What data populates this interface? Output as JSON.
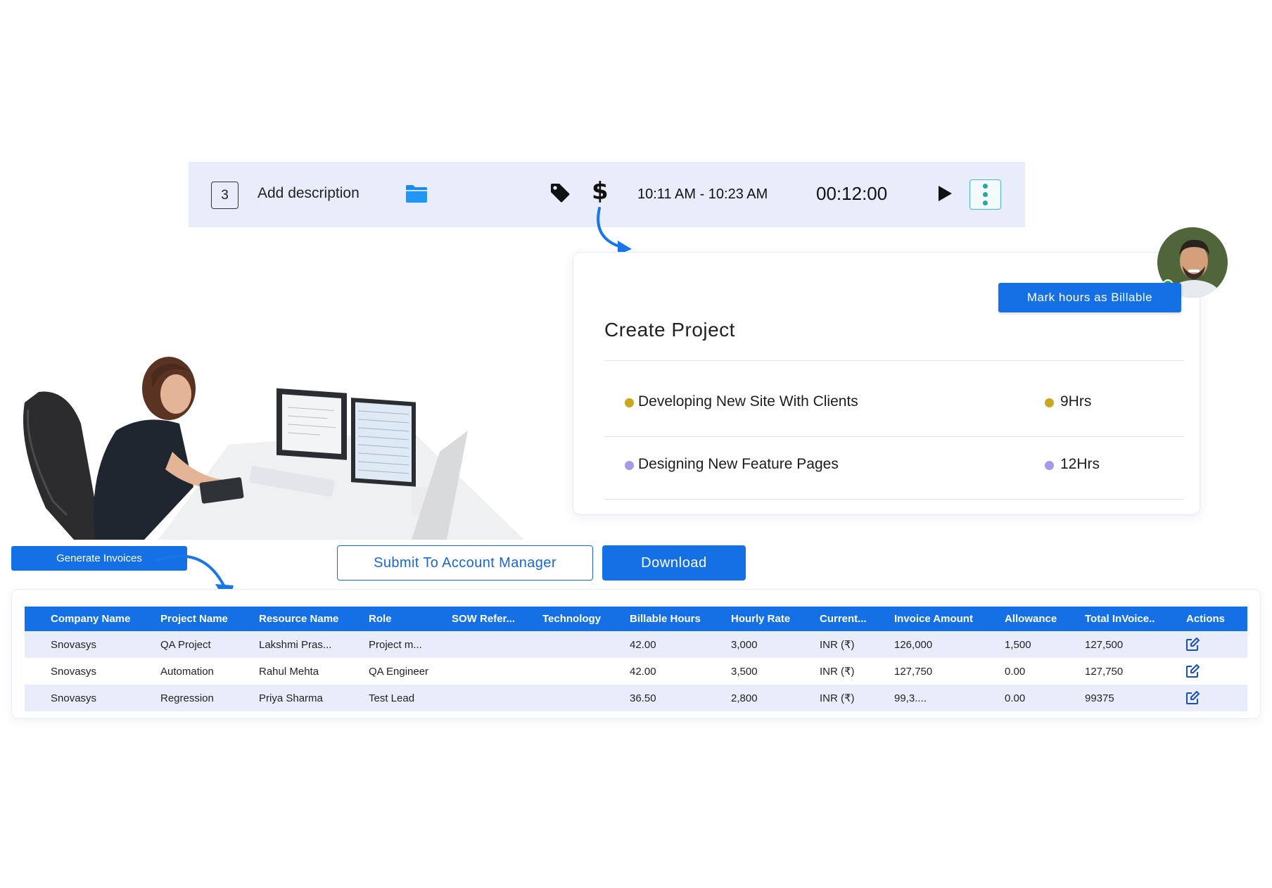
{
  "time_entry": {
    "count": "3",
    "description_placeholder": "Add description",
    "icons": {
      "project": "folder-icon",
      "tags": "tag-icon",
      "billable": "dollar-icon",
      "start": "play-icon",
      "more": "more-vertical-icon"
    },
    "dollar": "$",
    "time_range": "10:11 AM - 10:23 AM",
    "duration": "00:12:00"
  },
  "project_card": {
    "billable_button": "Mark hours as Billable",
    "title": "Create Project",
    "rows": [
      {
        "name": "Developing New Site With Clients",
        "hours": "9Hrs",
        "color": "#c9a81c"
      },
      {
        "name": "Designing New Feature Pages",
        "hours": "12Hrs",
        "color": "#a39be8"
      }
    ],
    "avatar_status_color": "#1fb44a"
  },
  "actions": {
    "generate_invoices": "Generate Invoices",
    "submit": "Submit To Account Manager",
    "download": "Download"
  },
  "invoice_table": {
    "columns": [
      "Company Name",
      "Project Name",
      "Resource Name",
      "Role",
      "SOW Refer...",
      "Technology",
      "Billable Hours",
      "Hourly Rate",
      "Current...",
      "Invoice Amount",
      "Allowance",
      "Total InVoice..",
      "Actions"
    ],
    "rows": [
      [
        "Snovasys",
        "QA Project",
        "Lakshmi Pras...",
        "Project m...",
        "",
        "",
        "42.00",
        "3,000",
        "INR (₹)",
        "126,000",
        "1,500",
        "127,500"
      ],
      [
        "Snovasys",
        "Automation",
        "Rahul Mehta",
        "QA Engineer",
        "",
        "",
        "42.00",
        "3,500",
        "INR (₹)",
        "127,750",
        "0.00",
        "127,750"
      ],
      [
        "Snovasys",
        "Regression",
        "Priya Sharma",
        "Test Lead",
        "",
        "",
        "36.50",
        "2,800",
        "INR (₹)",
        "99,3....",
        "0.00",
        "99375"
      ]
    ],
    "action_icon": "edit-icon"
  },
  "colors": {
    "primary": "#1570e6",
    "bar_bg": "#e9edfb",
    "folder": "#1a8cf0"
  }
}
